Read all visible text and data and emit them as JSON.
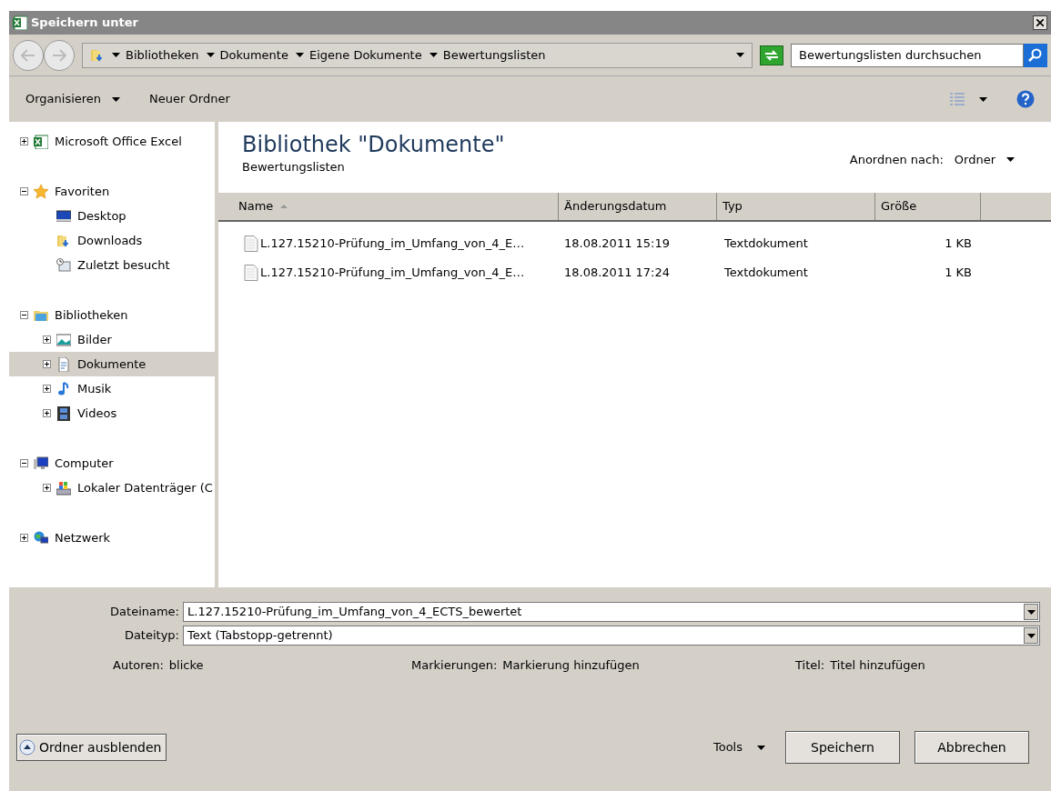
{
  "window": {
    "title": "Speichern unter"
  },
  "address_bar": {
    "crumbs": [
      "Bibliotheken",
      "Dokumente",
      "Eigene Dokumente",
      "Bewertungslisten"
    ]
  },
  "search": {
    "placeholder": "Bewertungslisten durchsuchen"
  },
  "toolbar": {
    "items": [
      "Organisieren",
      "Neuer Ordner"
    ]
  },
  "sidebar": {
    "items": [
      {
        "label": "Microsoft Office Excel",
        "kind": "excel",
        "expanded": false,
        "selected": false
      },
      {
        "label": "Favoriten",
        "kind": "star",
        "expanded": true,
        "selected": false,
        "children": [
          {
            "label": "Desktop",
            "kind": "desktop",
            "selected": false
          },
          {
            "label": "Downloads",
            "kind": "downloads",
            "selected": false
          },
          {
            "label": "Zuletzt besucht",
            "kind": "recent",
            "selected": false
          }
        ]
      },
      {
        "label": "Bibliotheken",
        "kind": "library",
        "expanded": true,
        "selected": false,
        "children": [
          {
            "label": "Bilder",
            "kind": "pictures",
            "expanded": false,
            "selected": false
          },
          {
            "label": "Dokumente",
            "kind": "documents",
            "expanded": false,
            "selected": true
          },
          {
            "label": "Musik",
            "kind": "music",
            "expanded": false,
            "selected": false
          },
          {
            "label": "Videos",
            "kind": "videos",
            "expanded": false,
            "selected": false
          }
        ]
      },
      {
        "label": "Computer",
        "kind": "computer",
        "expanded": true,
        "selected": false,
        "children": [
          {
            "label": "Lokaler Datenträger (C",
            "kind": "drive",
            "expanded": false,
            "selected": false
          }
        ]
      },
      {
        "label": "Netzwerk",
        "kind": "network",
        "expanded": false,
        "selected": false
      }
    ]
  },
  "content": {
    "title": "Bibliothek \"Dokumente\"",
    "subtitle": "Bewertungslisten",
    "arrange_label": "Anordnen nach:",
    "arrange_value": "Ordner"
  },
  "table": {
    "columns": [
      {
        "label": "Name",
        "sorted": true
      },
      {
        "label": "Änderungsdatum",
        "sorted": false
      },
      {
        "label": "Typ",
        "sorted": false
      },
      {
        "label": "Größe",
        "sorted": false
      }
    ],
    "rows": [
      [
        "L.127.15210-Prüfung_im_Umfang_von_4_E…",
        "18.08.2011 15:19",
        "Textdokument",
        "1 KB"
      ],
      [
        "L.127.15210-Prüfung_im_Umfang_von_4_E…",
        "18.08.2011 17:24",
        "Textdokument",
        "1 KB"
      ]
    ]
  },
  "form": {
    "filename_label": "Dateiname:",
    "filename": "L.127.15210-Prüfung_im_Umfang_von_4_ECTS_bewertet",
    "filetype_label": "Dateityp:",
    "filetype": "Text (Tabstopp-getrennt)"
  },
  "metadata": [
    {
      "label": "Autoren:",
      "value": "blicke"
    },
    {
      "label": "Markierungen:",
      "value": "Markierung hinzufügen"
    },
    {
      "label": "Titel:",
      "value": "Titel hinzufügen"
    }
  ],
  "footer": {
    "hide_folders": "Ordner ausblenden",
    "tools": "Tools",
    "buttons": [
      "Speichern",
      "Abbrechen"
    ]
  }
}
